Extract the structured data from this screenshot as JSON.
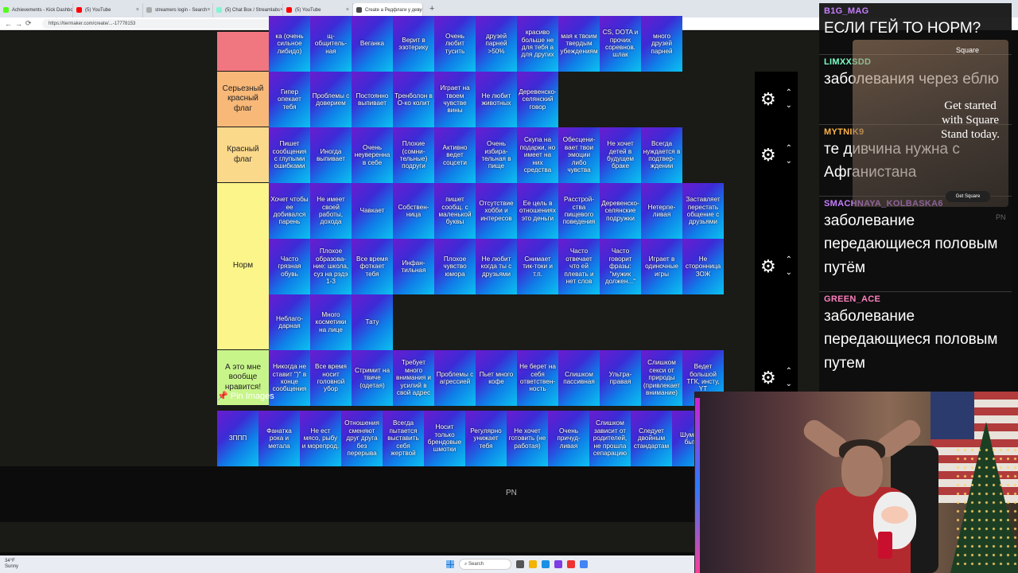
{
  "browser": {
    "tabs": [
      {
        "label": "Achievements - Kick Dashboard",
        "color": "#53fc18"
      },
      {
        "label": "(5) YouTube",
        "color": "#ff0000"
      },
      {
        "label": "streamers login - Search",
        "color": "#aaaaaa"
      },
      {
        "label": "(5) Chat Box / Streamlabs",
        "color": "#80f5d2"
      },
      {
        "label": "(5) YouTube",
        "color": "#ff0000"
      },
      {
        "label": "Create a Редфлаги у девушки Ti",
        "color": "#4a4a4a"
      }
    ],
    "new_tab": "+",
    "url": "https://tiermaker.com/create/...-17778153"
  },
  "tiers": [
    {
      "label": "",
      "color": "#f07680",
      "items": [
        "ка (очень сильное либидо)",
        "щ-общитель-ная",
        "Веганка",
        "Верит в эзотерику",
        "Очень любит тусить",
        "друзей парней >50%",
        "красиво больше не для тебя а для других",
        "мая к твоим твердым убеждениям",
        "CS, DOTA и прочих соревнов. шлак",
        "много друзей парней"
      ]
    },
    {
      "label": "Серьезный красный флаг",
      "color": "#f8b878",
      "items": [
        "Гипер опекает тебя",
        "Проблемы с доверием",
        "Постоянно выпивает",
        "Тренболон в О-ко колит",
        "Играет на твоем чувстве вины",
        "Не любит животных",
        "Деревенско-селянский говор"
      ]
    },
    {
      "label": "Красный флаг",
      "color": "#fbd98a",
      "items": [
        "Пишет сообщения с глупыми ошибками",
        "Иногда выпивает",
        "Очень неуверенна в себе",
        "Плохие (сомни-тельные) подруги",
        "Активно ведет соцсети",
        "Очень избира-тельная в пище",
        "Скупа на подарки, но имеет на них средства",
        "Обесцени-вает твои эмоции либо чувства",
        "Не хочет детей в будущем браке",
        "Всегда нуждается в подтвер-ждении"
      ]
    },
    {
      "label": "Норм",
      "color": "#fbf58a",
      "items": [
        "Хочет чтобы ее добивался парень",
        "Не имеет своей работы, дохода",
        "Чавкает",
        "Собствен-ница",
        "пишет сообщ. с маленькой буквы",
        "Отсутствие хобби и интересов",
        "Ее цель в отношениях это деньги",
        "Расстрой-ства пищевого поведения",
        "Деревенско-селянские подружки",
        "Нетерпе-ливая",
        "Заставляет перестать общение с друзьями",
        "Часто грязная обувь",
        "Плохое образова-ние: школа, суз на рэдэ 1-3",
        "Все время фоткает тебя",
        "Инфан-тильная",
        "Плохое чувство юмора",
        "Не любит когда ты с друзьями",
        "Снимает тик-токи и т.п.",
        "Часто отвечает что ей плевать и нет слов",
        "Часто говорит фразы: \"мужик должен...\"",
        "Играет в одиночные игры",
        "Не сторонница ЗОЖ",
        "Неблаго-дарная",
        "Много косметики на лице",
        "Тату"
      ]
    },
    {
      "label": "А это мне вообще нравится!",
      "color": "#c8f58a",
      "items": [
        "Никогда не ставит \")\" в конце сообщения",
        "Все время носит головной убор",
        "Стримит на твиче (одетая)",
        "Требует много внимания и усилий в свой адрес",
        "Проблемы с агрессией",
        "Пьет много кофе",
        "Не берет на себя ответствен-ность",
        "Слишком пассивная",
        "Ультра-правая",
        "Слишком секси от природы (привлекает внимание)",
        "Ведет большой ТГК, инсту, YT"
      ]
    }
  ],
  "controls": {
    "gear_icon": "⚙",
    "up_icon": "⌃",
    "down_icon": "⌄"
  },
  "pin": {
    "icon": "📌",
    "label": "Pin Images"
  },
  "pool": [
    "ЗППП",
    "Фанатка рока и метала",
    "Не ест мясо, рыбу и морепрод.",
    "Отношения сменяют друг друга без перерыва",
    "Всегда пытается выставить себя жертвой",
    "Носит только брендовые шмотки",
    "Регулярно унижает тебя",
    "Не хочет готовить (не работая)",
    "Очень причуд-ливая",
    "Слишком зависит от родителей, не прошла сепарацию",
    "Следует двойным стандартам",
    "Шумный быть,"
  ],
  "pool_watermark": "PN",
  "taskbar": {
    "weather_temp": "34°F",
    "weather_text": "Sunny",
    "search": "Search"
  },
  "chat": [
    {
      "user": "B1G_MAG",
      "color": "#c77dff",
      "text": "ЕСЛИ ГЕЙ ТО НОРМ?"
    },
    {
      "user": "LIMXXSDD",
      "color": "#7cffc7",
      "text": "заболевания через еблю"
    },
    {
      "user": "MYTNIK9",
      "color": "#ffb347",
      "text": "те дивчина нужна с Афганистана"
    },
    {
      "user": "SMACHNAYA_KOLBASKA6",
      "color": "#c77dff",
      "text": "заболевание передающиеся половым путём"
    },
    {
      "user": "GREEN_ACE",
      "color": "#ff7fbf",
      "text": "заболевание передающиеся половым путем"
    }
  ],
  "ad": {
    "brand": "Square",
    "title": "Get started with Square Stand today.",
    "button": "Get Square"
  },
  "chat_watermark": "PN"
}
